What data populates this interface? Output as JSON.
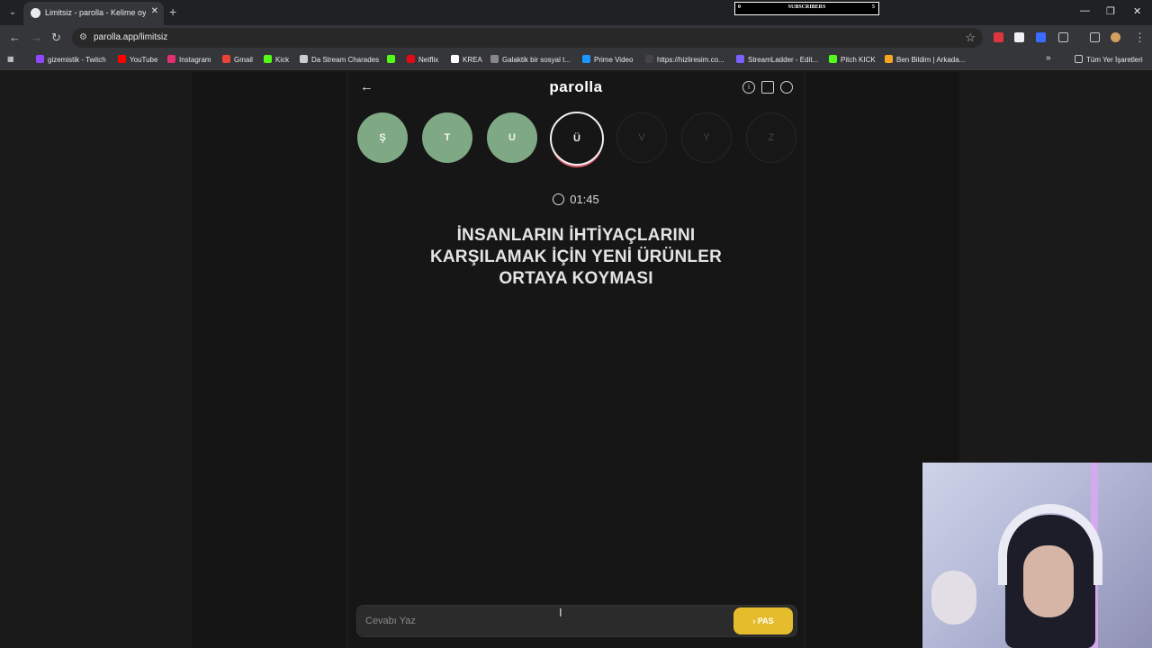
{
  "browser": {
    "tab_title": "Limitsiz - parolla - Kelime oyunu",
    "url": "parolla.app/limitsiz",
    "subscribers": {
      "left": "0",
      "label": "SUBSCRIBERS",
      "right": "5"
    },
    "bookmarks": [
      {
        "label": "gizemistik - Twitch",
        "icon_color": "#9146ff"
      },
      {
        "label": "YouTube",
        "icon_color": "#ff0000"
      },
      {
        "label": "Instagram",
        "icon_color": "#e1306c"
      },
      {
        "label": "Gmail",
        "icon_color": "#ea4335"
      },
      {
        "label": "Kick",
        "icon_color": "#53fc18"
      },
      {
        "label": "Da Stream Charades",
        "icon_color": "#cccccc"
      },
      {
        "label": "",
        "icon_color": "#53fc18"
      },
      {
        "label": "Netflix",
        "icon_color": "#e50914"
      },
      {
        "label": "KREA",
        "icon_color": "#ffffff"
      },
      {
        "label": "Galaktik bir sosyal t...",
        "icon_color": "#888888"
      },
      {
        "label": "Prime Video",
        "icon_color": "#1a98ff"
      },
      {
        "label": "https://hizliresim.co...",
        "icon_color": "#444444"
      },
      {
        "label": "StreamLadder - Edit...",
        "icon_color": "#7b61ff"
      },
      {
        "label": "Pitch KICK",
        "icon_color": "#53fc18"
      },
      {
        "label": "Ben Bildim | Arkada...",
        "icon_color": "#f5a623"
      }
    ],
    "all_bookmarks": "Tüm Yer İşaretleri"
  },
  "app": {
    "logo": "parolla",
    "letters": [
      {
        "letter": "Ş",
        "state": "done"
      },
      {
        "letter": "T",
        "state": "done"
      },
      {
        "letter": "U",
        "state": "done"
      },
      {
        "letter": "Ü",
        "state": "active"
      },
      {
        "letter": "V",
        "state": "future"
      },
      {
        "letter": "Y",
        "state": "future"
      },
      {
        "letter": "Z",
        "state": "future"
      }
    ],
    "timer": "01:45",
    "question": "İNSANLARIN İHTİYAÇLARINI KARŞILAMAK İÇİN YENİ ÜRÜNLER ORTAYA KOYMASI",
    "answer_placeholder": "Cevabı Yaz",
    "pass_label": "PAS"
  },
  "colors": {
    "done": "#7fa985",
    "pass": "#e5bd2c",
    "active_ring": "#e05a6a"
  }
}
